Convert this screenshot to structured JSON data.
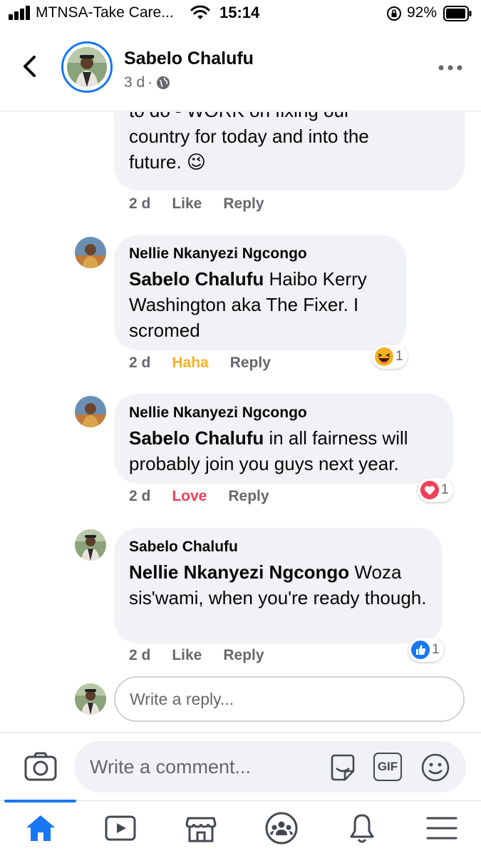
{
  "status_bar": {
    "carrier": "MTNSA-Take Care...",
    "time": "15:14",
    "battery": "92%"
  },
  "header": {
    "name": "Sabelo Chalufu",
    "age": "3 d",
    "dot": "·"
  },
  "comments": [
    {
      "author": "",
      "text_lines": [
        "to do - WORK on fixing our",
        "country for today and into the",
        "future. 😉"
      ],
      "time": "2 d",
      "like_label": "Like",
      "reply_label": "Reply"
    },
    {
      "author": "Nellie Nkanyezi Ngcongo",
      "mention": "Sabelo Chalufu",
      "text": " Haibo Kerry Washington aka The Fixer. I scromed",
      "time": "2 d",
      "like_label": "Haha",
      "reply_label": "Reply",
      "reaction": "haha",
      "reaction_count": "1"
    },
    {
      "author": "Nellie Nkanyezi Ngcongo",
      "mention": "Sabelo Chalufu",
      "text": " in all fairness will probably join you guys next year.",
      "time": "2 d",
      "like_label": "Love",
      "reply_label": "Reply",
      "reaction": "love",
      "reaction_count": "1"
    },
    {
      "author": "Sabelo Chalufu",
      "mention": "Nellie Nkanyezi Ngcongo",
      "text": " Woza sis'wami, when you're ready though.",
      "time": "2 d",
      "like_label": "Like",
      "reply_label": "Reply",
      "reaction": "like",
      "reaction_count": "1"
    }
  ],
  "reply_input": {
    "placeholder": "Write a reply..."
  },
  "composer": {
    "placeholder": "Write a comment...",
    "gif_label": "GIF"
  },
  "colors": {
    "accent": "#1877f2",
    "haha": "#f7b125",
    "love": "#f33e58",
    "secondary_text": "#65676b",
    "bubble": "#f0f2f5"
  },
  "icons": {
    "back": "chevron-left-icon",
    "privacy": "globe-icon",
    "more": "more-horizontal-icon",
    "camera": "camera-icon",
    "sticker": "sticker-icon",
    "gif": "gif-icon",
    "emoji": "smiley-icon",
    "tabs": [
      "home-icon",
      "watch-icon",
      "marketplace-icon",
      "groups-icon",
      "notifications-icon",
      "menu-icon"
    ]
  }
}
